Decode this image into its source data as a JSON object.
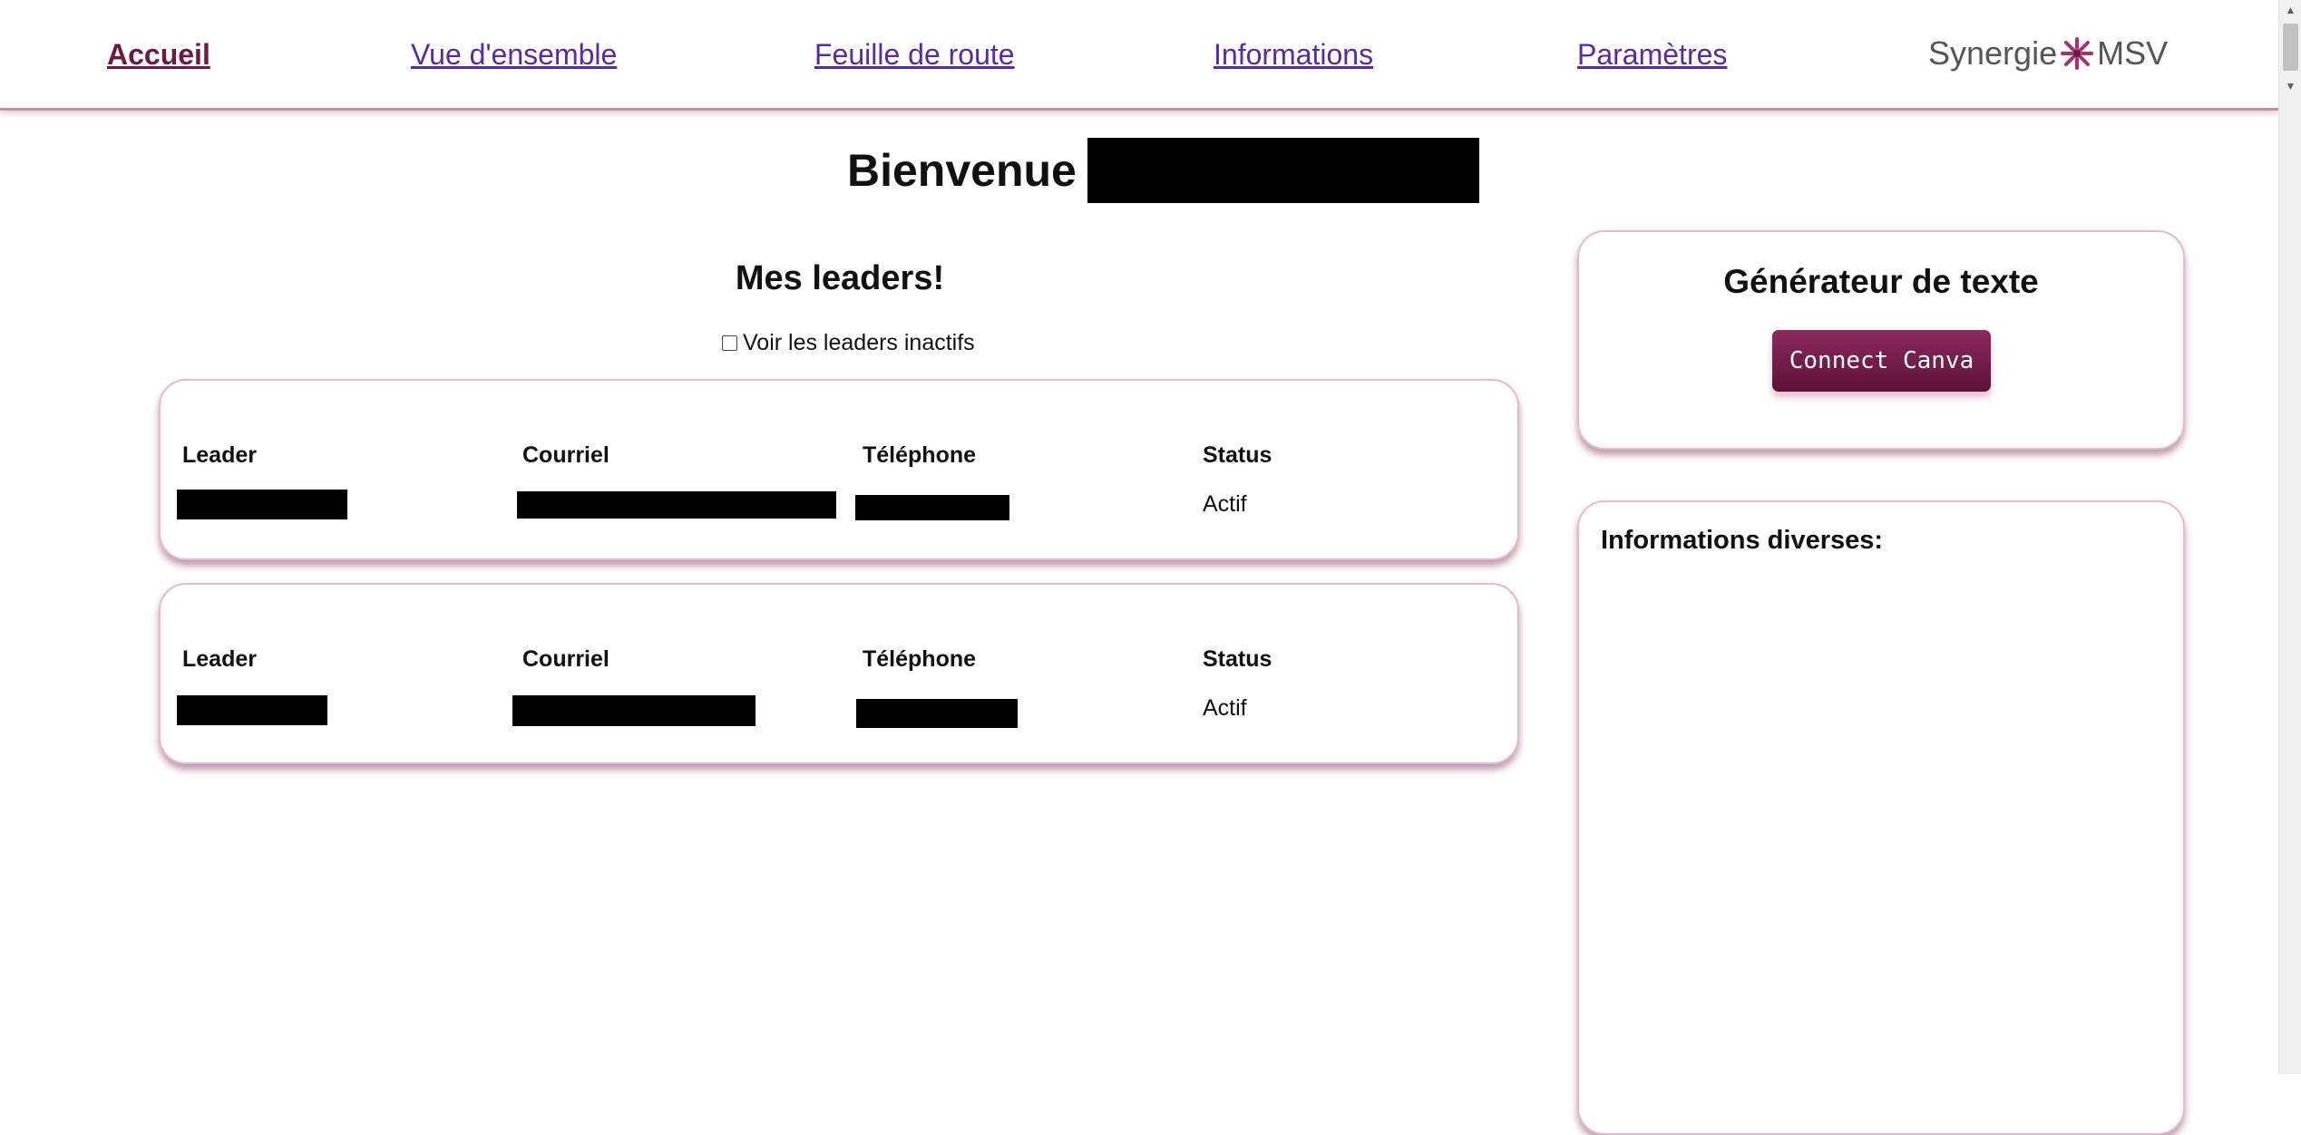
{
  "nav": {
    "items": [
      {
        "label": "Accueil",
        "active": true
      },
      {
        "label": "Vue d'ensemble",
        "active": false
      },
      {
        "label": "Feuille de route",
        "active": false
      },
      {
        "label": "Informations",
        "active": false
      },
      {
        "label": "Paramètres",
        "active": false
      }
    ],
    "brand_left": "Synergie",
    "brand_right": "MSV",
    "brand_icon": "synergie-logo-icon"
  },
  "welcome": {
    "title": "Bienvenue"
  },
  "leaders": {
    "title": "Mes leaders!",
    "show_inactive_label": "Voir les leaders inactifs",
    "show_inactive_checked": false,
    "columns": {
      "leader": "Leader",
      "email": "Courriel",
      "phone": "Téléphone",
      "status": "Status"
    },
    "rows": [
      {
        "status": "Actif"
      },
      {
        "status": "Actif"
      }
    ]
  },
  "generator": {
    "title": "Générateur de texte",
    "button_label": "Connect Canva"
  },
  "info": {
    "title": "Informations diverses:"
  },
  "colors": {
    "accent": "#6b1a45",
    "link": "#5a2aa0",
    "card_border": "#e7b9cf"
  }
}
